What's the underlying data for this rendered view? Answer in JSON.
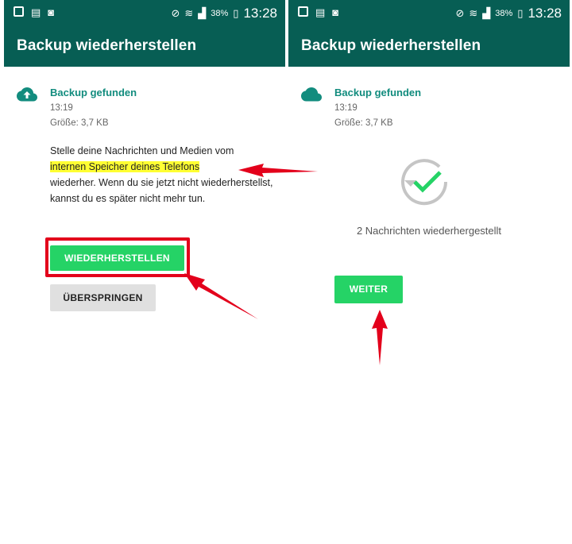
{
  "status_bar": {
    "battery_percent": "38%",
    "time": "13:28"
  },
  "left_screen": {
    "app_bar_title": "Backup wiederherstellen",
    "backup_found_label": "Backup gefunden",
    "backup_time": "13:19",
    "backup_size": "Größe: 3,7 KB",
    "description_part1": "Stelle deine Nachrichten und Medien vom",
    "description_highlight": "internen Speicher deines Telefons",
    "description_part2": "wiederher. Wenn du sie jetzt nicht wiederherstellst, kannst du es später nicht mehr tun.",
    "restore_button": "WIEDERHERSTELLEN",
    "skip_button": "ÜBERSPRINGEN"
  },
  "right_screen": {
    "app_bar_title": "Backup wiederherstellen",
    "backup_found_label": "Backup gefunden",
    "backup_time": "13:19",
    "backup_size": "Größe: 3,7 KB",
    "restored_message": "2 Nachrichten wiederhergestellt",
    "continue_button": "WEITER"
  },
  "icons": {
    "upload_cloud": "cloud-upload-icon",
    "cloud": "cloud-icon",
    "restore_done": "check-circle-icon"
  },
  "colors": {
    "primary_dark": "#075e54",
    "accent_green": "#25d366",
    "teal_text": "#128c7e",
    "highlight": "#ffff33",
    "annotation_red": "#e3001b"
  }
}
